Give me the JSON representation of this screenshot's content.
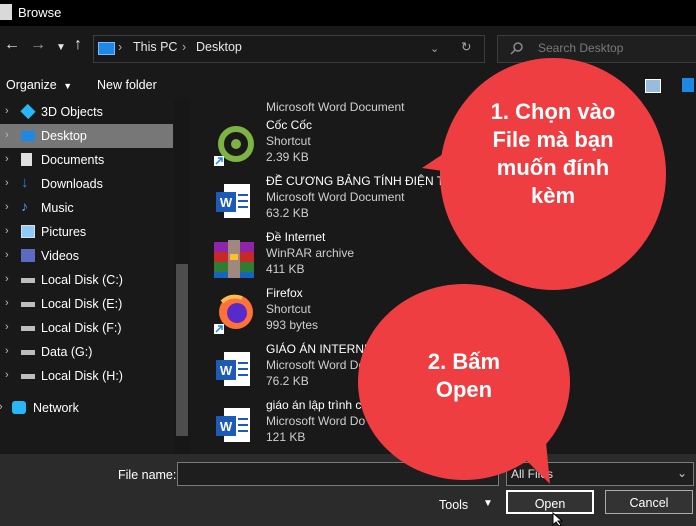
{
  "window": {
    "title": "Browse"
  },
  "address": {
    "crumbs": [
      "This PC",
      "Desktop"
    ]
  },
  "search": {
    "placeholder": "Search Desktop"
  },
  "commandbar": {
    "organize": "Organize",
    "new_folder": "New folder"
  },
  "sidebar": {
    "items": [
      {
        "label": "3D Objects",
        "icon": "cube-icon"
      },
      {
        "label": "Desktop",
        "icon": "desktop-icon",
        "selected": true
      },
      {
        "label": "Documents",
        "icon": "documents-icon"
      },
      {
        "label": "Downloads",
        "icon": "download-arrow-icon"
      },
      {
        "label": "Music",
        "icon": "music-note-icon"
      },
      {
        "label": "Pictures",
        "icon": "pictures-icon"
      },
      {
        "label": "Videos",
        "icon": "videos-icon"
      },
      {
        "label": "Local Disk (C:)",
        "icon": "drive-icon"
      },
      {
        "label": "Local Disk (E:)",
        "icon": "drive-icon"
      },
      {
        "label": "Local Disk (F:)",
        "icon": "drive-icon"
      },
      {
        "label": "Data (G:)",
        "icon": "drive-icon"
      },
      {
        "label": "Local Disk (H:)",
        "icon": "drive-icon"
      },
      {
        "label": "Network",
        "icon": "network-icon"
      }
    ]
  },
  "files": [
    {
      "name": "",
      "type": "Microsoft Word Document",
      "size": "",
      "icon": "word-doc-icon"
    },
    {
      "name": "Cốc Cốc",
      "type": "Shortcut",
      "size": "2.39 KB",
      "icon": "coccoc-icon"
    },
    {
      "name": "ĐỀ CƯƠNG BẢNG TÍNH ĐIỆN TỬ",
      "type": "Microsoft Word Document",
      "size": "63.2 KB",
      "icon": "word-doc-icon"
    },
    {
      "name": "Đề Internet",
      "type": "WinRAR archive",
      "size": "411 KB",
      "icon": "winrar-icon"
    },
    {
      "name": "Firefox",
      "type": "Shortcut",
      "size": "993 bytes",
      "icon": "firefox-icon"
    },
    {
      "name": "GIÁO ÁN INTERNE",
      "type": "Microsoft Word Do",
      "size": "76.2 KB",
      "icon": "word-doc-icon"
    },
    {
      "name": "giáo án lập trình c",
      "type": "Microsoft Word Do",
      "size": "121 KB",
      "icon": "word-doc-icon"
    }
  ],
  "bottom": {
    "file_name_label": "File name:",
    "file_name_value": "",
    "file_type": "All Files",
    "tools": "Tools",
    "open": "Open",
    "cancel": "Cancel"
  },
  "annotations": {
    "step1": [
      "1. Chọn vào",
      "File mà bạn",
      "muốn đính",
      "kèm"
    ],
    "step2": [
      "2. Bấm",
      "Open"
    ]
  },
  "colors": {
    "bubble": "#ef3e42",
    "selection": "#777777",
    "accent": "#1e88e5"
  }
}
